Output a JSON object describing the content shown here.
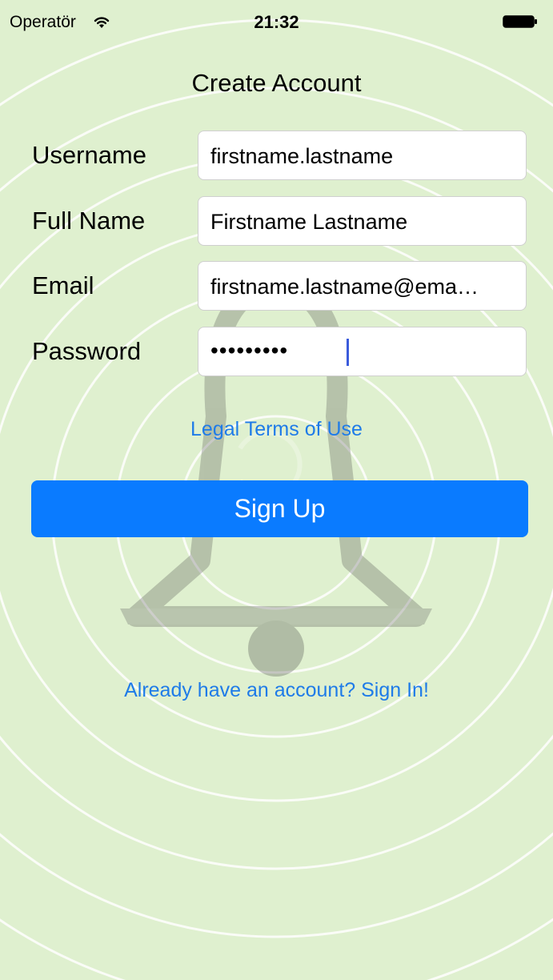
{
  "status_bar": {
    "carrier": "Operatör",
    "time": "21:32",
    "wifi_icon": "wifi-icon",
    "battery_icon": "battery-icon"
  },
  "screen_title": "Create Account",
  "form": {
    "username": {
      "label": "Username",
      "value": "firstname.lastname"
    },
    "full_name": {
      "label": "Full Name",
      "value": "Firstname Lastname"
    },
    "email": {
      "label": "Email",
      "value": "firstname.lastname@ema…"
    },
    "password": {
      "label": "Password",
      "value": "•••••••••"
    }
  },
  "legal_link": "Legal Terms of Use",
  "signup_button": "Sign Up",
  "signin_link": "Already have an account? Sign In!",
  "colors": {
    "background": "#dff0cf",
    "accent": "#0a7bff",
    "link": "#1e7be8"
  },
  "background_icon": "bell-icon"
}
